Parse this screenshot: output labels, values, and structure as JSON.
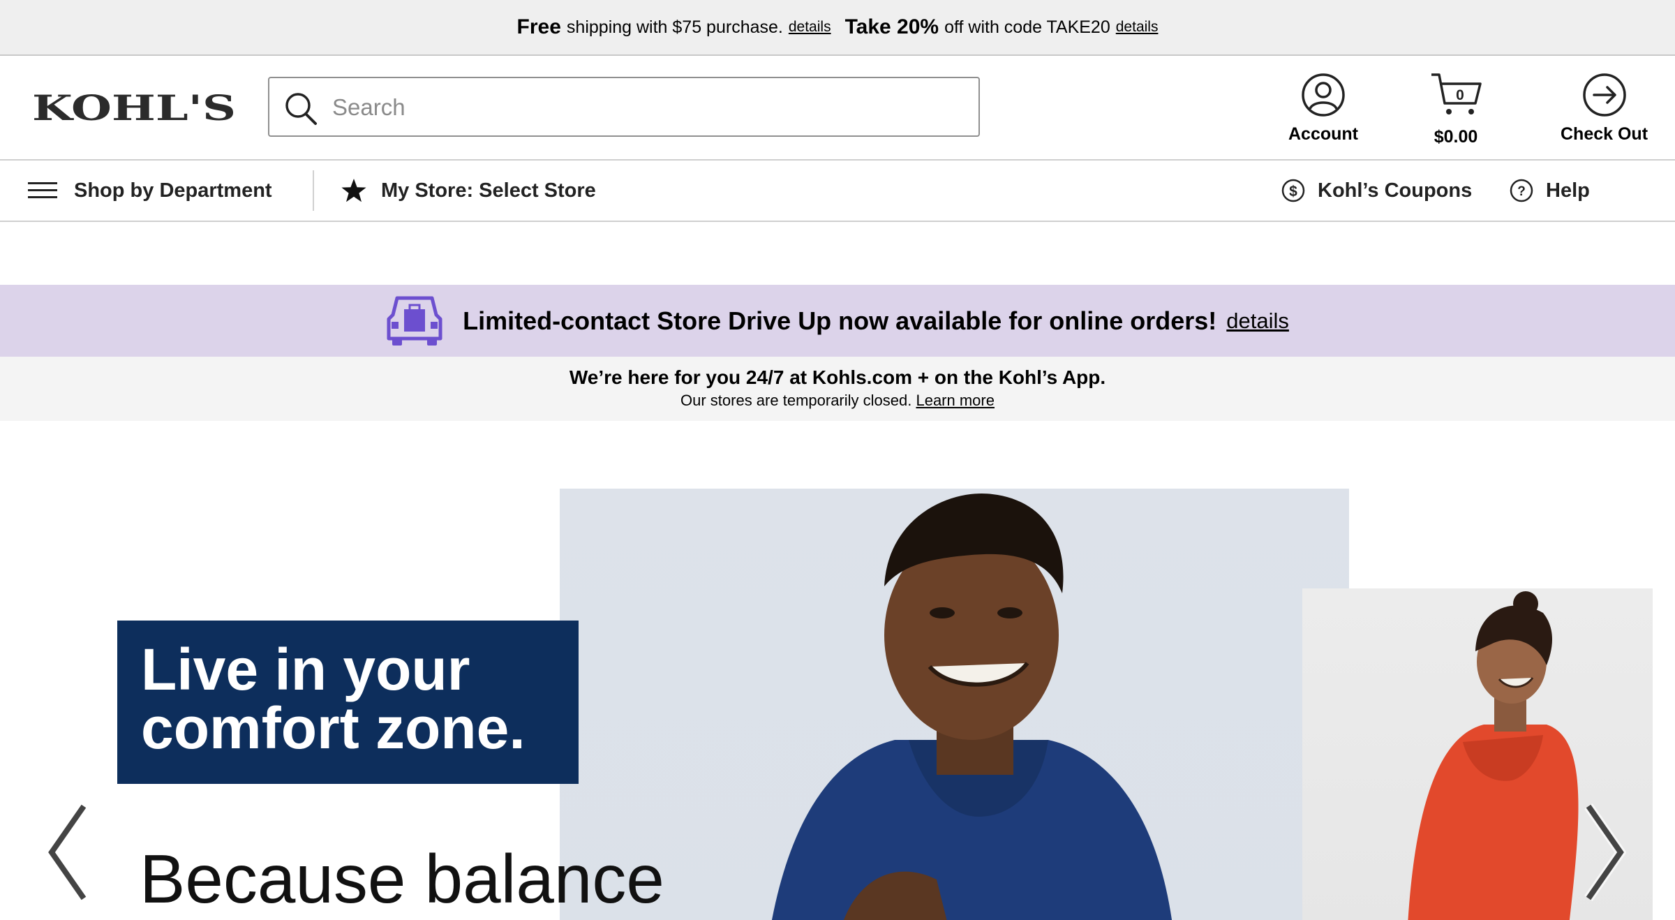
{
  "promo": {
    "free_bold": "Free",
    "free_text": "shipping with $75 purchase.",
    "free_link": "details",
    "take_bold": "Take 20%",
    "take_text": "off with code TAKE20",
    "take_link": "details"
  },
  "header": {
    "logo_text": "KOHL'S",
    "search_placeholder": "Search",
    "account_label": "Account",
    "cart_count": "0",
    "cart_total": "$0.00",
    "checkout_label": "Check Out"
  },
  "nav": {
    "shop_by_department": "Shop by Department",
    "my_store": "My Store: Select Store",
    "coupons": "Kohl’s Coupons",
    "help": "Help"
  },
  "driveup": {
    "message": "Limited-contact Store Drive Up now available for online orders!",
    "link": "details"
  },
  "notice": {
    "headline": "We’re here for you 24/7 at Kohls.com + on the Kohl’s App.",
    "body": "Our stores are temporarily closed.",
    "link": "Learn more"
  },
  "hero": {
    "headline_line1": "Live in your",
    "headline_line2": "comfort zone.",
    "subline": "Because balance"
  },
  "colors": {
    "brand_navy": "#0d2e5c",
    "driveup_bg": "#dcd3ea",
    "driveup_icon": "#6c4fcf"
  }
}
